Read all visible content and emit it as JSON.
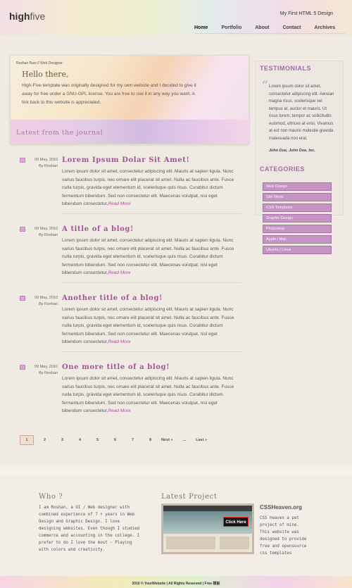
{
  "header": {
    "logo_bold": "high",
    "logo_light": "five",
    "tagline": "My First HTML 5 Design",
    "nav": [
      "Home",
      "Portfolio",
      "About",
      "Contact",
      "Archives"
    ]
  },
  "hero": {
    "role": "Roshan Ravi // Web Designer",
    "greeting": "Hello there,",
    "text": "High-Five template was originally designed for my own website and I decided to give it away for free under a GNU-GPL license. You are free to use it in any way you want. A link back to this website is appreciated.",
    "latest": "Latest from the journal"
  },
  "posts": [
    {
      "date": "09 May, 2010",
      "author": "By Roshan",
      "title": "Lorem Ipsum Dolar Sit Amet!",
      "body": "Lorem ipsum dolor sit amet, consectetur adipiscing elit. Mauris at sapien ligula. Nunc varius faucibus turpis, nec ornare elit placerat sit amet. Nulla ac faucibus ante. Fusce nulla turpis, gravida eget elementum id, scelerisque quis risus. Curabitur dictum fermentum bibendum. Sed non consectetur elit. Maecenas volutpat, nisl eget bibendum consectetur,",
      "more": "Read More"
    },
    {
      "date": "09 May, 2010",
      "author": "By Roshan",
      "title": "A title of a blog!",
      "body": "Lorem ipsum dolor sit amet, consectetur adipiscing elit. Mauris at sapien ligula. Nunc varius faucibus turpis, nec ornare elit placerat sit amet. Nulla ac faucibus ante. Fusce nulla turpis, gravida eget elementum id, scelerisque quis risus. Curabitur dictum fermentum bibendum. Sed non consectetur elit. Maecenas volutpat, nisl eget bibendum consectetur,",
      "more": "Read More"
    },
    {
      "date": "09 May, 2010",
      "author": "By Roshan",
      "title": "Another title of a blog!",
      "body": "Lorem ipsum dolor sit amet, consectetur adipiscing elit. Mauris at sapien ligula. Nunc varius faucibus turpis, nec ornare elit placerat sit amet. Nulla ac faucibus ante. Fusce nulla turpis, gravida eget elementum id, scelerisque quis risus. Curabitur dictum fermentum bibendum. Sed non consectetur elit. Maecenas volutpat, nisl eget bibendum consectetur,",
      "more": "Read More"
    },
    {
      "date": "09 May, 2010",
      "author": "By Roshan",
      "title": "One more title of a blog!",
      "body": "Lorem ipsum dolor sit amet, consectetur adipiscing elit. Mauris at sapien ligula. Nunc varius faucibus turpis, nec ornare elit placerat sit amet. Nulla ac faucibus ante. Fusce nulla turpis, gravida eget elementum id, scelerisque quis risus. Curabitur dictum fermentum bibendum. Sed non consectetur elit. Maecenas volutpat, nisl eget bibendum consectetur,",
      "more": "Read More"
    }
  ],
  "pagination": {
    "current": "1",
    "pages": [
      "2",
      "3",
      "4",
      "5",
      "6",
      "7",
      "8"
    ],
    "next": "Next »",
    "ellipsis": "...",
    "last": "Last »"
  },
  "sidebar": {
    "testimonials_title": "TESTIMONIALS",
    "quote_mark": "“",
    "testimonial": "Lorem ipsum dolor sit amet, consectetur adipiscing elit. Aenean magna risus, scelerisque vel tempus at, auctor et mauris. Ut risus lorem, tempor ac sollicitudin euismod, ultrices at eros. Vivamus at est non mauris molestie gravida malesuada non erat.",
    "testimonial_author": "John Doe, John Doe, Inc.",
    "categories_title": "CATEGORIES",
    "categories": [
      "Web Design",
      "Site News",
      "CSS Templates",
      "Graphic Design",
      "Photoshop",
      "Apple / Mac",
      "Ubuntu / Linux"
    ]
  },
  "footer": {
    "who_title": "Who ?",
    "who_text": "I am Roshan, a UI / Web designer with combined experience of 7 + years in Web Design and Graphic Design. I love designing websites. Even though I studied commerce and accounting in the college. I prefer to do I love the most - Playing with colors and creativity.",
    "project_title": "Latest Project",
    "project_name": "CSSHeaven.org",
    "project_desc": "CSS heaven a pet project of mine. This website was designed to provide free and opensource css templates",
    "thumb_button": "Click Here",
    "copyright": "2010 © YourWebsite | All Rights Reserved | Free 模板"
  },
  "colors": {
    "accent_purple": "#a5529d",
    "category_bg": "#c494c2",
    "page_bg": "#efebe3"
  }
}
